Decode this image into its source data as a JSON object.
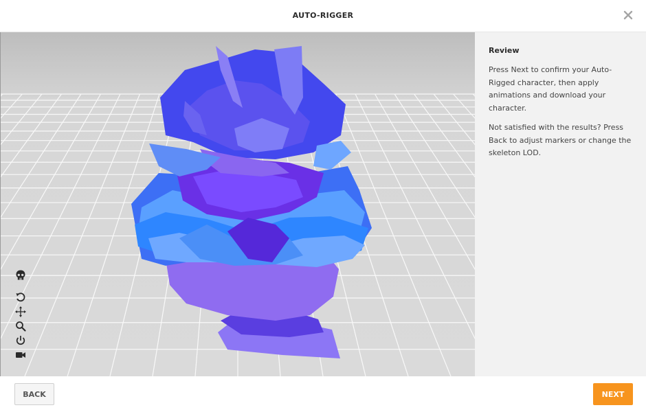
{
  "header": {
    "title": "AUTO-RIGGER",
    "close_icon": "close-icon"
  },
  "viewport": {
    "background_color": "#d8d8d8",
    "tools": [
      "skeleton-icon",
      "rotate-icon",
      "pan-icon",
      "zoom-icon",
      "reset-icon",
      "camera-icon"
    ]
  },
  "side_panel": {
    "heading": "Review",
    "paragraph1": "Press Next to confirm your Auto-Rigged character, then apply animations and download your character.",
    "paragraph2": "Not satisfied with the results? Press Back to adjust markers or change the skeleton LOD."
  },
  "footer": {
    "back_label": "BACK",
    "next_label": "NEXT",
    "accent_color": "#f7941e"
  }
}
